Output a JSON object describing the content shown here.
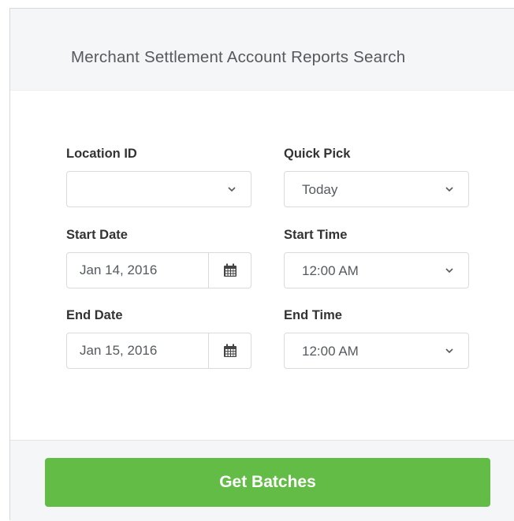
{
  "header": {
    "title": "Merchant Settlement Account Reports Search"
  },
  "form": {
    "location_id": {
      "label": "Location ID",
      "value": ""
    },
    "quick_pick": {
      "label": "Quick Pick",
      "value": "Today"
    },
    "start_date": {
      "label": "Start Date",
      "value": "Jan 14, 2016"
    },
    "start_time": {
      "label": "Start Time",
      "value": "12:00 AM"
    },
    "end_date": {
      "label": "End Date",
      "value": "Jan 15, 2016"
    },
    "end_time": {
      "label": "End Time",
      "value": "12:00 AM"
    }
  },
  "footer": {
    "submit_label": "Get Batches"
  },
  "colors": {
    "accent_green": "#63bc46",
    "header_bg": "#f5f6f7",
    "border": "#d8dbde"
  },
  "icons": {
    "dropdown": "chevron-down-icon",
    "date_picker": "calendar-icon"
  }
}
